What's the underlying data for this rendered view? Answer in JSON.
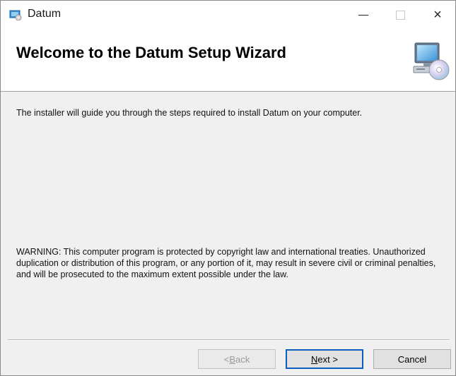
{
  "window": {
    "title": "Datum",
    "controls": {
      "minimize": "minimize",
      "maximize": "maximize",
      "close": "×"
    }
  },
  "banner": {
    "title": "Welcome to the Datum Setup Wizard",
    "icon": "computer-cd-icon"
  },
  "body": {
    "intro": "The installer will guide you through the steps required to install Datum on your computer.",
    "warning": "WARNING: This computer program is protected by copyright law and international treaties. Unauthorized duplication or distribution of this program, or any portion of it, may result in severe civil or criminal penalties, and will be prosecuted to the maximum extent possible under the law."
  },
  "buttons": {
    "back": {
      "mnemonic": "B",
      "rest": "ack",
      "prefix": "< ",
      "enabled": false
    },
    "next": {
      "mnemonic": "N",
      "rest": "ext >",
      "default": true
    },
    "cancel": {
      "label": "Cancel"
    }
  },
  "colors": {
    "default_button_border": "#0a5fbf",
    "panel_background": "#f0f0f0",
    "banner_background": "#ffffff"
  }
}
